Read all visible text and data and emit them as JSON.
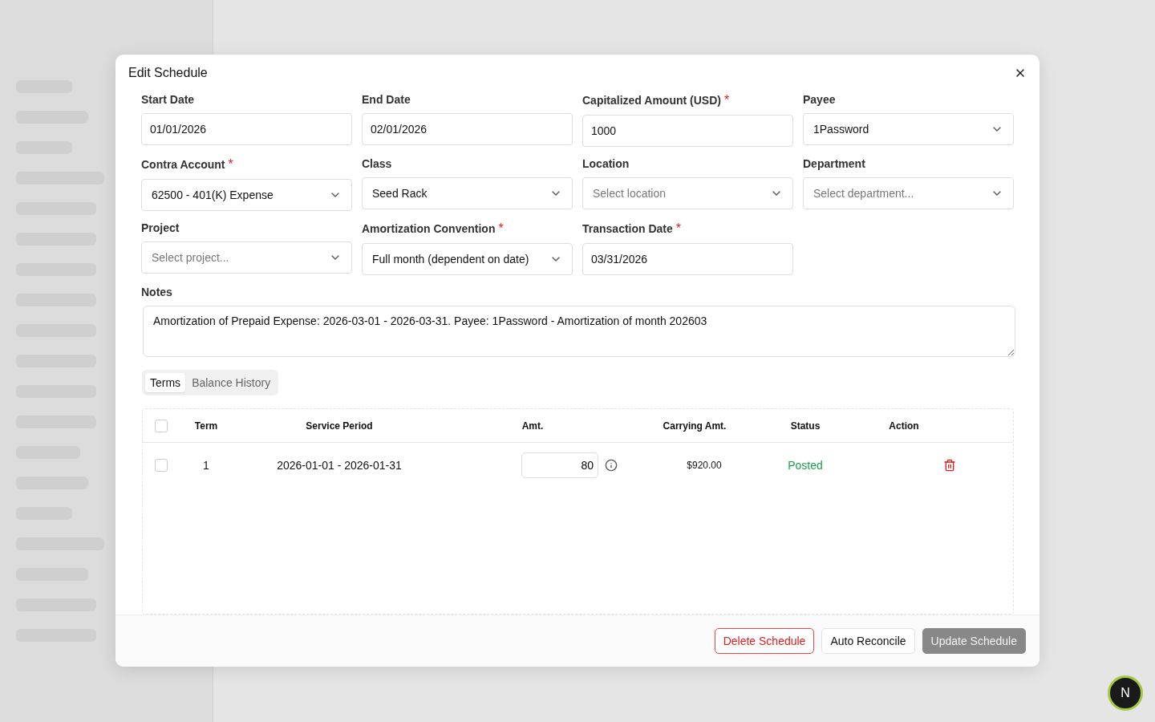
{
  "dialog": {
    "title": "Edit Schedule",
    "fields": [
      {
        "label": "Start Date",
        "kind": "text",
        "value": "01/01/2026"
      },
      {
        "label": "End Date",
        "kind": "text",
        "value": "02/01/2026"
      },
      {
        "label": "Capitalized Amount (USD)",
        "kind": "text",
        "value": "1000",
        "required_mark": "*"
      },
      {
        "label": "Payee",
        "kind": "select",
        "value": "1Password"
      },
      {
        "label": "Contra Account",
        "kind": "select",
        "value": "62500 - 401(K) Expense",
        "required_mark": "*"
      },
      {
        "label": "Class",
        "kind": "select",
        "value": "Seed Rack"
      },
      {
        "label": "Location",
        "kind": "select",
        "placeholder": "Select location"
      },
      {
        "label": "Department",
        "kind": "select",
        "placeholder": "Select department..."
      },
      {
        "label": "Project",
        "kind": "select",
        "placeholder": "Select project..."
      },
      {
        "label": "Amortization Convention",
        "kind": "select",
        "value": "Full month (dependent on date)",
        "required_mark": "*"
      },
      {
        "label": "Transaction Date",
        "kind": "text",
        "value": "03/31/2026",
        "required_mark": "*"
      }
    ],
    "notes": {
      "label": "Notes",
      "value": "Amortization of Prepaid Expense: 2026-03-01 - 2026-03-31. Payee: 1Password - Amortization of month 202603"
    },
    "tabs": [
      {
        "label": "Terms",
        "selected": true
      },
      {
        "label": "Balance History",
        "selected": false
      }
    ],
    "table": {
      "all_checked": false,
      "columns": [
        "Term",
        "Service Period",
        "Amt.",
        "Carrying Amt.",
        "Status",
        "Action"
      ],
      "rows": [
        {
          "checked": false,
          "term": "1",
          "service_period": "2026-01-01 - 2026-01-31",
          "amount": "80",
          "carrying_amount": "$920.00",
          "status": "Posted",
          "color": "#16a34a"
        }
      ]
    },
    "buttons": [
      {
        "label": "Delete Schedule",
        "kind": "danger"
      },
      {
        "label": "Auto Reconcile",
        "kind": "outline"
      },
      {
        "label": "Update Schedule",
        "kind": "primary",
        "disabled": true
      }
    ]
  },
  "dev_badge": "N"
}
